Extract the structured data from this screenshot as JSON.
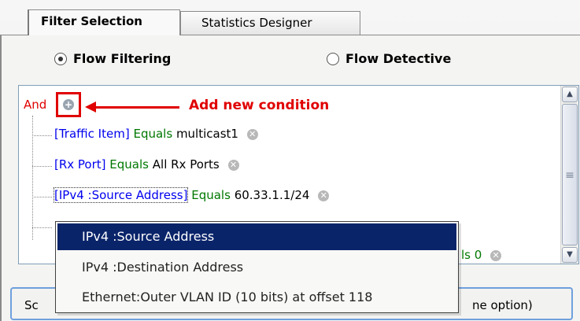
{
  "tabs": [
    {
      "label": "Filter Selection",
      "active": true
    },
    {
      "label": "Statistics Designer",
      "active": false
    }
  ],
  "radios": [
    {
      "label": "Flow Filtering",
      "checked": true
    },
    {
      "label": "Flow Detective",
      "checked": false
    }
  ],
  "tree": {
    "root_label": "And",
    "annotation": "Add new condition",
    "conditions": [
      {
        "field": "[Traffic Item]",
        "op": "Equals",
        "value": "multicast1"
      },
      {
        "field": "[Rx Port]",
        "op": "Equals",
        "value": "All Rx Ports"
      },
      {
        "field": "[IPv4 :Source Address]",
        "op": "Equals",
        "value": "60.33.1.1/24"
      },
      {
        "field": "",
        "op": "",
        "value": "ls 0"
      }
    ]
  },
  "dropdown": {
    "options": [
      "IPv4 :Source Address",
      "IPv4 :Destination Address",
      "Ethernet:Outer VLAN ID (10 bits) at offset 118"
    ],
    "selected_index": 0
  },
  "bottom_hint": {
    "left_text": "Sc",
    "right_text": "ne option)"
  },
  "colors": {
    "annotation": "#e00000",
    "field": "#0000ee",
    "operator": "#007800",
    "selection": "#0a246a"
  },
  "icons": {
    "add": "plus-circle-icon",
    "remove": "x-circle-icon"
  }
}
